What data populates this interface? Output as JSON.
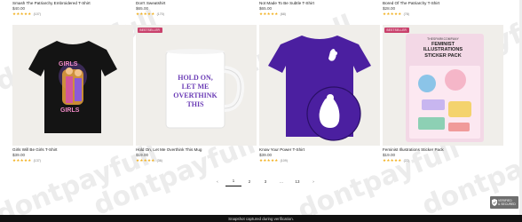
{
  "top_row": [
    {
      "name": "Smash The Patriarchy Embroidered T-Shirt",
      "price": "$40.00",
      "stars": "★★★★★",
      "reviews": "(107)"
    },
    {
      "name": "Don't Sweatshirt",
      "price": "$65.00",
      "stars": "★★★★★",
      "reviews": "(170)"
    },
    {
      "name": "Not Made To Be Subtle T-Shirt",
      "price": "$65.00",
      "stars": "★★★★★",
      "reviews": "(68)"
    },
    {
      "name": "Bored Of The Patriarchy T-Shirt",
      "price": "$28.00",
      "stars": "★★★★★",
      "reviews": "(78)"
    }
  ],
  "products": [
    {
      "name": "Girls Will Be Girls T-Shirt",
      "price": "$39.00",
      "stars": "★★★★★",
      "reviews": "(137)",
      "badge": "",
      "art": "GIRLS WILL BE GIRLS"
    },
    {
      "name": "Hold On, Let Me Overthink This Mug",
      "price": "$19.00",
      "stars": "★★★★★",
      "reviews": "(36)",
      "badge": "BESTSELLER",
      "art": "HOLD ON, LET ME OVERTHINK THIS"
    },
    {
      "name": "Know Your Power T-Shirt",
      "price": "$39.00",
      "stars": "★★★★★",
      "reviews": "(109)",
      "badge": "",
      "art": ""
    },
    {
      "name": "Feminist Illustrations Sticker Pack",
      "price": "$19.00",
      "stars": "★★★★★",
      "reviews": "(22)",
      "badge": "BESTSELLER",
      "art_brand": "THESPARKCOMPANY",
      "art_title": "FEMINIST ILLUSTRATIONS STICKER PACK"
    }
  ],
  "bestseller_label": "BESTSELLER",
  "pagination": {
    "prev": "‹",
    "pages": [
      "1",
      "2",
      "3",
      "...",
      "13"
    ],
    "next": "›",
    "active": "1"
  },
  "verified": {
    "line1": "VERIFIED",
    "line2": "& SECURED"
  },
  "footer_text": "Snapshot captured during verification.",
  "watermark": "dontpayfull",
  "colors": {
    "purple": "#4b1fa0",
    "badge": "#c9416c",
    "star": "#f2b01e"
  }
}
